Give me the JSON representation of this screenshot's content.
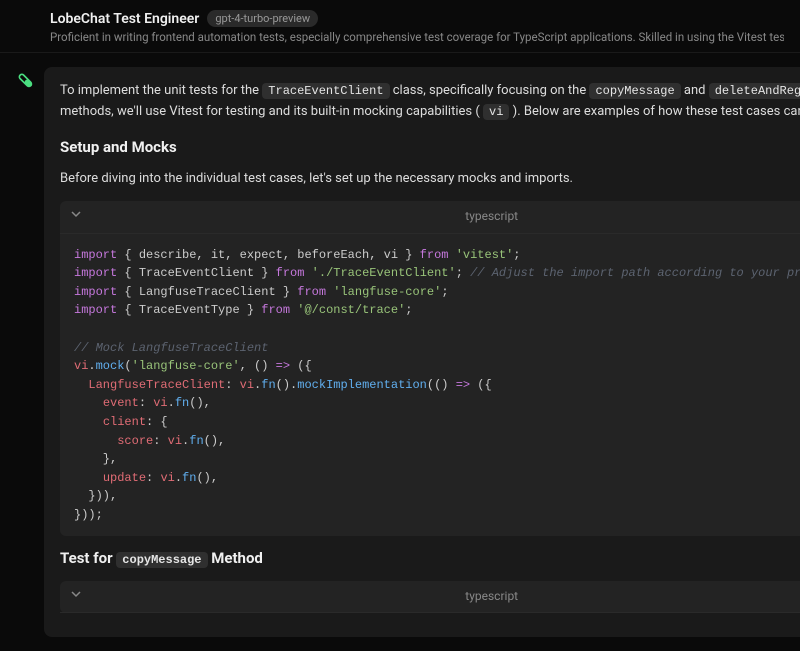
{
  "header": {
    "title": "LobeChat Test Engineer",
    "model": "gpt-4-turbo-preview",
    "subtitle": "Proficient in writing frontend automation tests, especially comprehensive test coverage for TypeScript applications. Skilled in using the Vitest testing framework with a deep understanding of testin"
  },
  "message": {
    "intro": {
      "p1a": "To implement the unit tests for the ",
      "c1": "TraceEventClient",
      "p1b": " class, specifically focusing on the ",
      "c2": "copyMessage",
      "p1c": " and ",
      "c3": "deleteAndRegenerateMessage",
      "p1d": " methods, we'll use Vitest for testing and its built-in mocking capabilities (",
      "c4": "vi",
      "p1e": "). Below are examples of how these test cases can be structured:"
    },
    "h_setup": "Setup and Mocks",
    "p_setup": "Before diving into the individual test cases, let's set up the necessary mocks and imports.",
    "code1_lang": "typescript",
    "h_test_a": "Test for ",
    "h_test_code": "copyMessage",
    "h_test_b": " Method",
    "code2_lang": "typescript"
  },
  "code1": {
    "l1": {
      "imports": "{ describe, it, expect, beforeEach, vi }",
      "from": "'vitest'"
    },
    "l2": {
      "imports": "{ TraceEventClient }",
      "from": "'./TraceEventClient'",
      "cmt": "// Adjust the import path according to your project structure"
    },
    "l3": {
      "imports": "{ LangfuseTraceClient }",
      "from": "'langfuse-core'"
    },
    "l4": {
      "imports": "{ TraceEventType }",
      "from": "'@/const/trace'"
    },
    "cmt_mock": "// Mock LangfuseTraceClient",
    "mock_mod": "'langfuse-core'",
    "prop_client": "LangfuseTraceClient",
    "prop_event": "event",
    "prop_clientkey": "client",
    "prop_score": "score",
    "prop_update": "update",
    "fn_vi": "vi",
    "fn_fn": "fn",
    "fn_mock": "mock",
    "fn_impl": "mockImplementation"
  },
  "chart_data": null
}
